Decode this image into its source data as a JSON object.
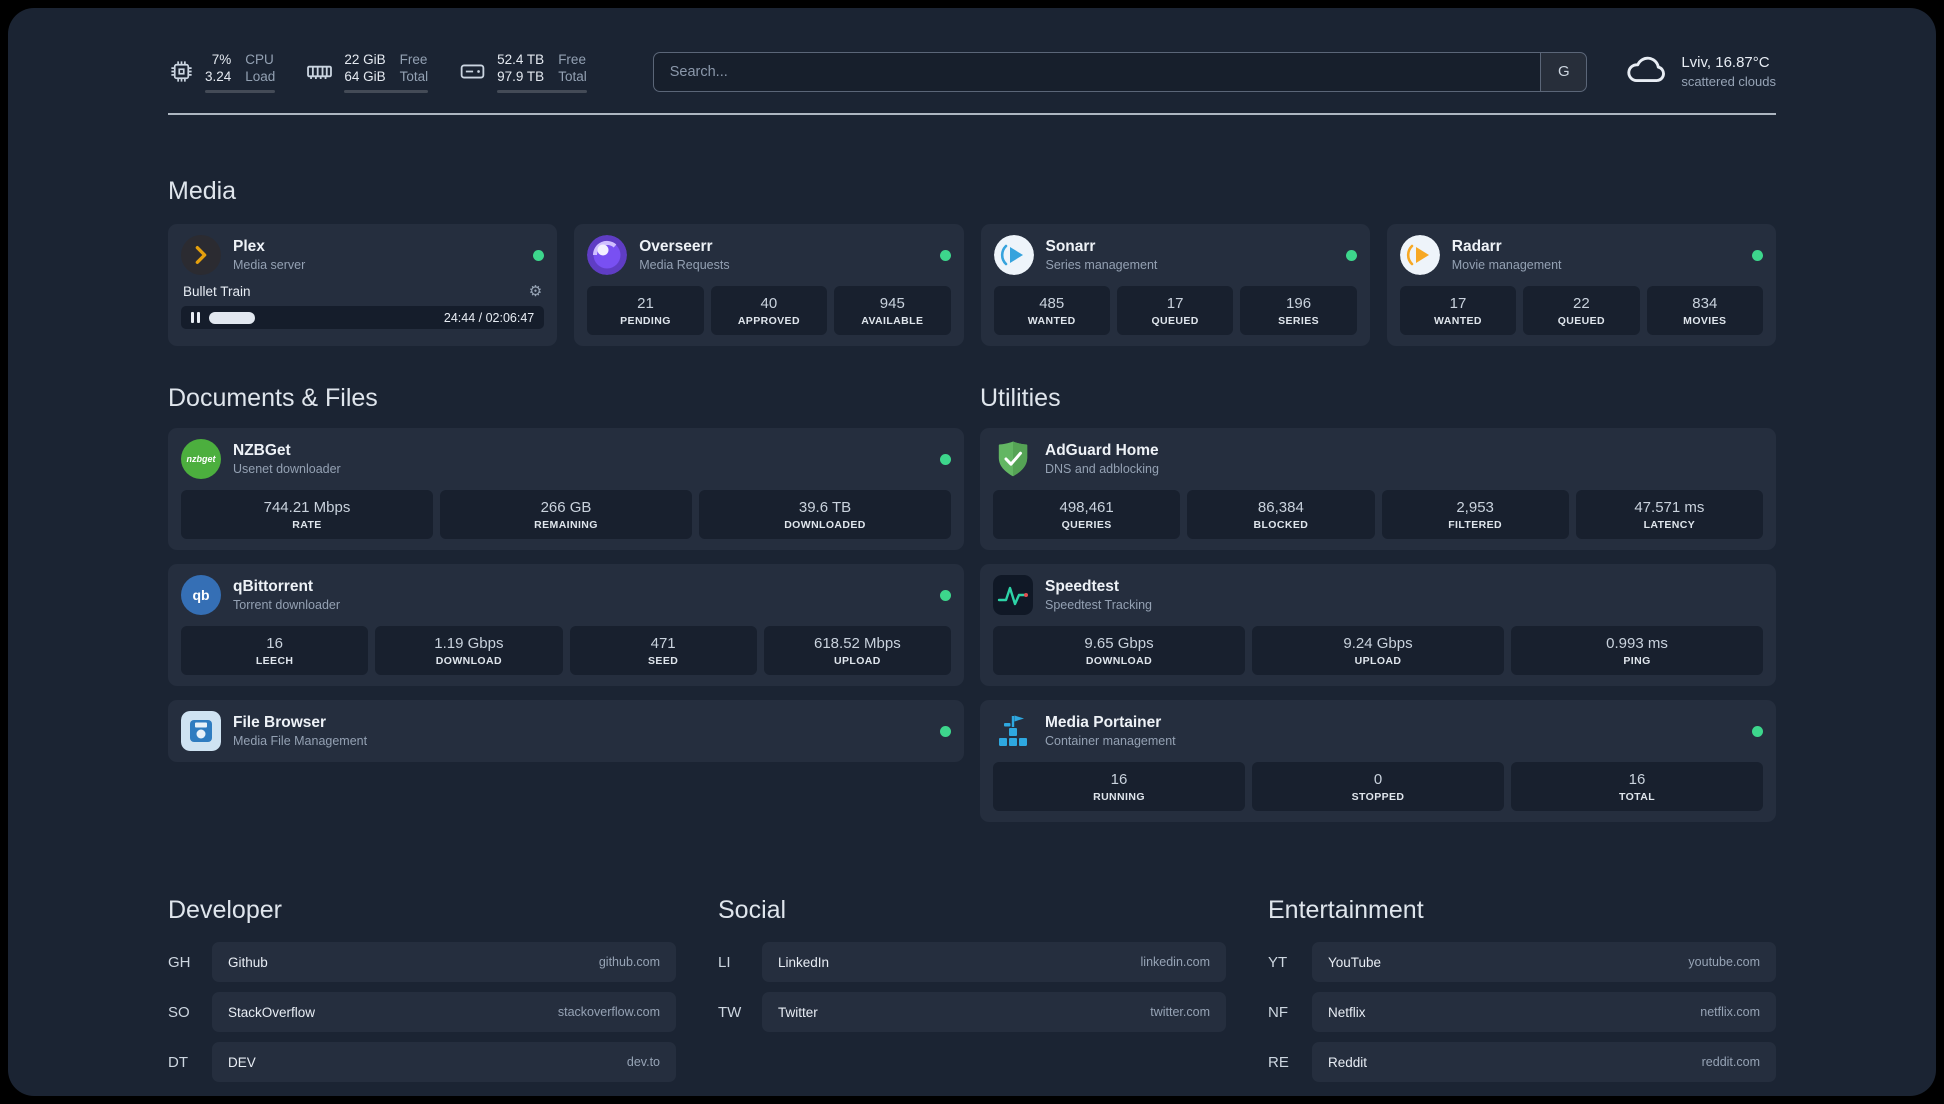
{
  "topbar": {
    "cpu": {
      "value1": "7%",
      "value2": "3.24",
      "label1": "CPU",
      "label2": "Load",
      "usage_pct": 7
    },
    "memory": {
      "value1": "22 GiB",
      "value2": "64 GiB",
      "label1": "Free",
      "label2": "Total",
      "usage_pct": 66
    },
    "disk": {
      "value1": "52.4 TB",
      "value2": "97.9 TB",
      "label1": "Free",
      "label2": "Total",
      "usage_pct": 47
    },
    "search": {
      "placeholder": "Search...",
      "provider_button": "G"
    },
    "weather": {
      "location": "Lviv, 16.87°C",
      "condition": "scattered clouds"
    }
  },
  "section_titles": {
    "media": "Media",
    "documents": "Documents & Files",
    "utilities": "Utilities",
    "developer": "Developer",
    "social": "Social",
    "entertainment": "Entertainment"
  },
  "services": {
    "plex": {
      "name": "Plex",
      "subtitle": "Media server",
      "status": "online",
      "now_playing": "Bullet Train",
      "playback_time": "24:44 / 02:06:47"
    },
    "overseerr": {
      "name": "Overseerr",
      "subtitle": "Media Requests",
      "status": "online",
      "stats": [
        {
          "value": "21",
          "label": "PENDING"
        },
        {
          "value": "40",
          "label": "APPROVED"
        },
        {
          "value": "945",
          "label": "AVAILABLE"
        }
      ]
    },
    "sonarr": {
      "name": "Sonarr",
      "subtitle": "Series management",
      "status": "online",
      "stats": [
        {
          "value": "485",
          "label": "WANTED"
        },
        {
          "value": "17",
          "label": "QUEUED"
        },
        {
          "value": "196",
          "label": "SERIES"
        }
      ]
    },
    "radarr": {
      "name": "Radarr",
      "subtitle": "Movie management",
      "status": "online",
      "stats": [
        {
          "value": "17",
          "label": "WANTED"
        },
        {
          "value": "22",
          "label": "QUEUED"
        },
        {
          "value": "834",
          "label": "MOVIES"
        }
      ]
    },
    "nzbget": {
      "name": "NZBGet",
      "subtitle": "Usenet downloader",
      "status": "online",
      "icon_text": "nzbget",
      "stats": [
        {
          "value": "744.21 Mbps",
          "label": "RATE"
        },
        {
          "value": "266 GB",
          "label": "REMAINING"
        },
        {
          "value": "39.6 TB",
          "label": "DOWNLOADED"
        }
      ]
    },
    "qbittorrent": {
      "name": "qBittorrent",
      "subtitle": "Torrent downloader",
      "status": "online",
      "icon_text": "qb",
      "stats": [
        {
          "value": "16",
          "label": "LEECH"
        },
        {
          "value": "1.19 Gbps",
          "label": "DOWNLOAD"
        },
        {
          "value": "471",
          "label": "SEED"
        },
        {
          "value": "618.52 Mbps",
          "label": "UPLOAD"
        }
      ]
    },
    "filebrowser": {
      "name": "File Browser",
      "subtitle": "Media File Management",
      "status": "online"
    },
    "adguard": {
      "name": "AdGuard Home",
      "subtitle": "DNS and adblocking",
      "stats": [
        {
          "value": "498,461",
          "label": "QUERIES"
        },
        {
          "value": "86,384",
          "label": "BLOCKED"
        },
        {
          "value": "2,953",
          "label": "FILTERED"
        },
        {
          "value": "47.571 ms",
          "label": "LATENCY"
        }
      ]
    },
    "speedtest": {
      "name": "Speedtest",
      "subtitle": "Speedtest Tracking",
      "stats": [
        {
          "value": "9.65 Gbps",
          "label": "DOWNLOAD"
        },
        {
          "value": "9.24 Gbps",
          "label": "UPLOAD"
        },
        {
          "value": "0.993 ms",
          "label": "PING"
        }
      ]
    },
    "portainer": {
      "name": "Media Portainer",
      "subtitle": "Container management",
      "status": "online",
      "stats": [
        {
          "value": "16",
          "label": "RUNNING"
        },
        {
          "value": "0",
          "label": "STOPPED"
        },
        {
          "value": "16",
          "label": "TOTAL"
        }
      ]
    }
  },
  "bookmarks": {
    "developer": [
      {
        "abbr": "GH",
        "name": "Github",
        "url": "github.com"
      },
      {
        "abbr": "SO",
        "name": "StackOverflow",
        "url": "stackoverflow.com"
      },
      {
        "abbr": "DT",
        "name": "DEV",
        "url": "dev.to"
      }
    ],
    "social": [
      {
        "abbr": "LI",
        "name": "LinkedIn",
        "url": "linkedin.com"
      },
      {
        "abbr": "TW",
        "name": "Twitter",
        "url": "twitter.com"
      }
    ],
    "entertainment": [
      {
        "abbr": "YT",
        "name": "YouTube",
        "url": "youtube.com"
      },
      {
        "abbr": "NF",
        "name": "Netflix",
        "url": "netflix.com"
      },
      {
        "abbr": "RE",
        "name": "Reddit",
        "url": "reddit.com"
      }
    ]
  },
  "colors": {
    "status_online": "#3dd68c",
    "plex_accent": "#e5a00d",
    "sonarr_accent": "#36a3dd",
    "radarr_accent": "#f7a824",
    "adguard_green": "#63b663",
    "portainer_blue": "#2ea8e0"
  }
}
